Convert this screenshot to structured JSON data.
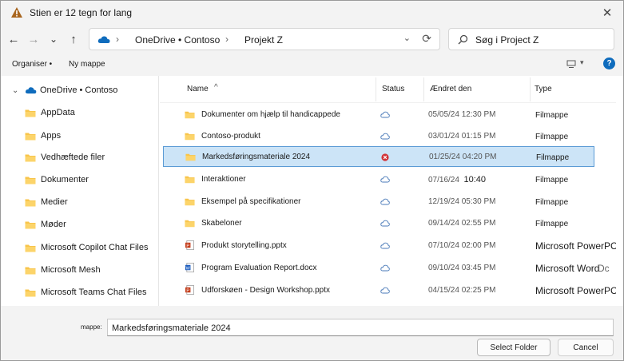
{
  "titlebar": {
    "title": "Stien er 12 tegn for lang",
    "close_glyph": "✕",
    "icons": {
      "warning": "warning-icon",
      "close": "close-icon"
    }
  },
  "navbar": {
    "back_glyph": "←",
    "forward_glyph": "→",
    "recent_glyph": "⌄",
    "up_glyph": "↑",
    "breadcrumbs": [
      "OneDrive • Contoso",
      "Projekt Z"
    ],
    "breadcrumb_sep": "›",
    "dropdown_glyph": "⌄",
    "refresh_glyph": "⟳",
    "search_placeholder": "Søg i Project Z"
  },
  "commandbar": {
    "organize_label": "Organiser •",
    "new_folder_label": "Ny mappe",
    "view_dd_glyph": "▾",
    "help_glyph": "?"
  },
  "sidebar": {
    "root_label": "OneDrive • Contoso",
    "root_chevron": "⌄",
    "items": [
      {
        "label": "AppData"
      },
      {
        "label": "Apps"
      },
      {
        "label": "Vedhæftede filer"
      },
      {
        "label": "Dokumenter"
      },
      {
        "label": "Medier"
      },
      {
        "label": "Møder"
      },
      {
        "label": "Microsoft Copilot Chat Files"
      },
      {
        "label": "Microsoft Mesh"
      },
      {
        "label": "Microsoft Teams Chat Files"
      }
    ]
  },
  "filelist": {
    "columns": {
      "name": "Name",
      "status": "Status",
      "modified": "Ændret den",
      "type": "Type"
    },
    "sort_glyph": "^",
    "rows": [
      {
        "name": "Dokumenter om hjælp til handicappede",
        "icon": "folder",
        "status": "cloud",
        "date": "05/05/24 12:30 PM",
        "time": "",
        "type": "Filmappe",
        "extra": ""
      },
      {
        "name": "Contoso-produkt",
        "icon": "folder",
        "status": "cloud",
        "date": "03/01/24 01:15 PM",
        "time": "",
        "type": "Filmappe",
        "extra": ""
      },
      {
        "name": "Markedsføringsmateriale 2024",
        "icon": "folder",
        "status": "error",
        "date": "01/25/24 04:20 PM",
        "time": "",
        "type": "Filmappe",
        "extra": "",
        "selected": true
      },
      {
        "name": "Interaktioner",
        "icon": "folder",
        "status": "cloud",
        "date": "07/16/24",
        "time": "10:40",
        "type": "Filmappe",
        "extra": ""
      },
      {
        "name": "Eksempel på specifikationer",
        "icon": "folder",
        "status": "cloud",
        "date": "12/19/24 05:30 PM",
        "time": "",
        "type": "Filmappe",
        "extra": ""
      },
      {
        "name": "Skabeloner",
        "icon": "folder",
        "status": "cloud",
        "date": "09/14/24 02:55 PM",
        "time": "",
        "type": "Filmappe",
        "extra": ""
      },
      {
        "name": "Produkt storytelling.pptx",
        "icon": "pptx",
        "status": "cloud",
        "date": "07/10/24 02:00 PM",
        "time": "",
        "type": "Microsoft PowerPC",
        "extra": ""
      },
      {
        "name": "Program Evaluation Report.docx",
        "icon": "docx",
        "status": "cloud",
        "date": "09/10/24 03:45 PM",
        "time": "",
        "type": "Microsoft Word",
        "extra": "Dc"
      },
      {
        "name": "Udforskøen - Design Workshop.pptx",
        "icon": "pptx",
        "status": "cloud",
        "date": "04/15/24 02:25 PM",
        "time": "",
        "type": "Microsoft PowerPC",
        "extra": ""
      }
    ]
  },
  "bottom": {
    "filename_label": "mappe:",
    "filename_value": "Markedsføringsmateriale 2024",
    "select_button": "Select Folder",
    "cancel_button": "Cancel"
  },
  "colors": {
    "accent": "#0f6cbd",
    "selection": "#cce4f7",
    "folder": "#f8c54b",
    "error": "#d13438"
  }
}
